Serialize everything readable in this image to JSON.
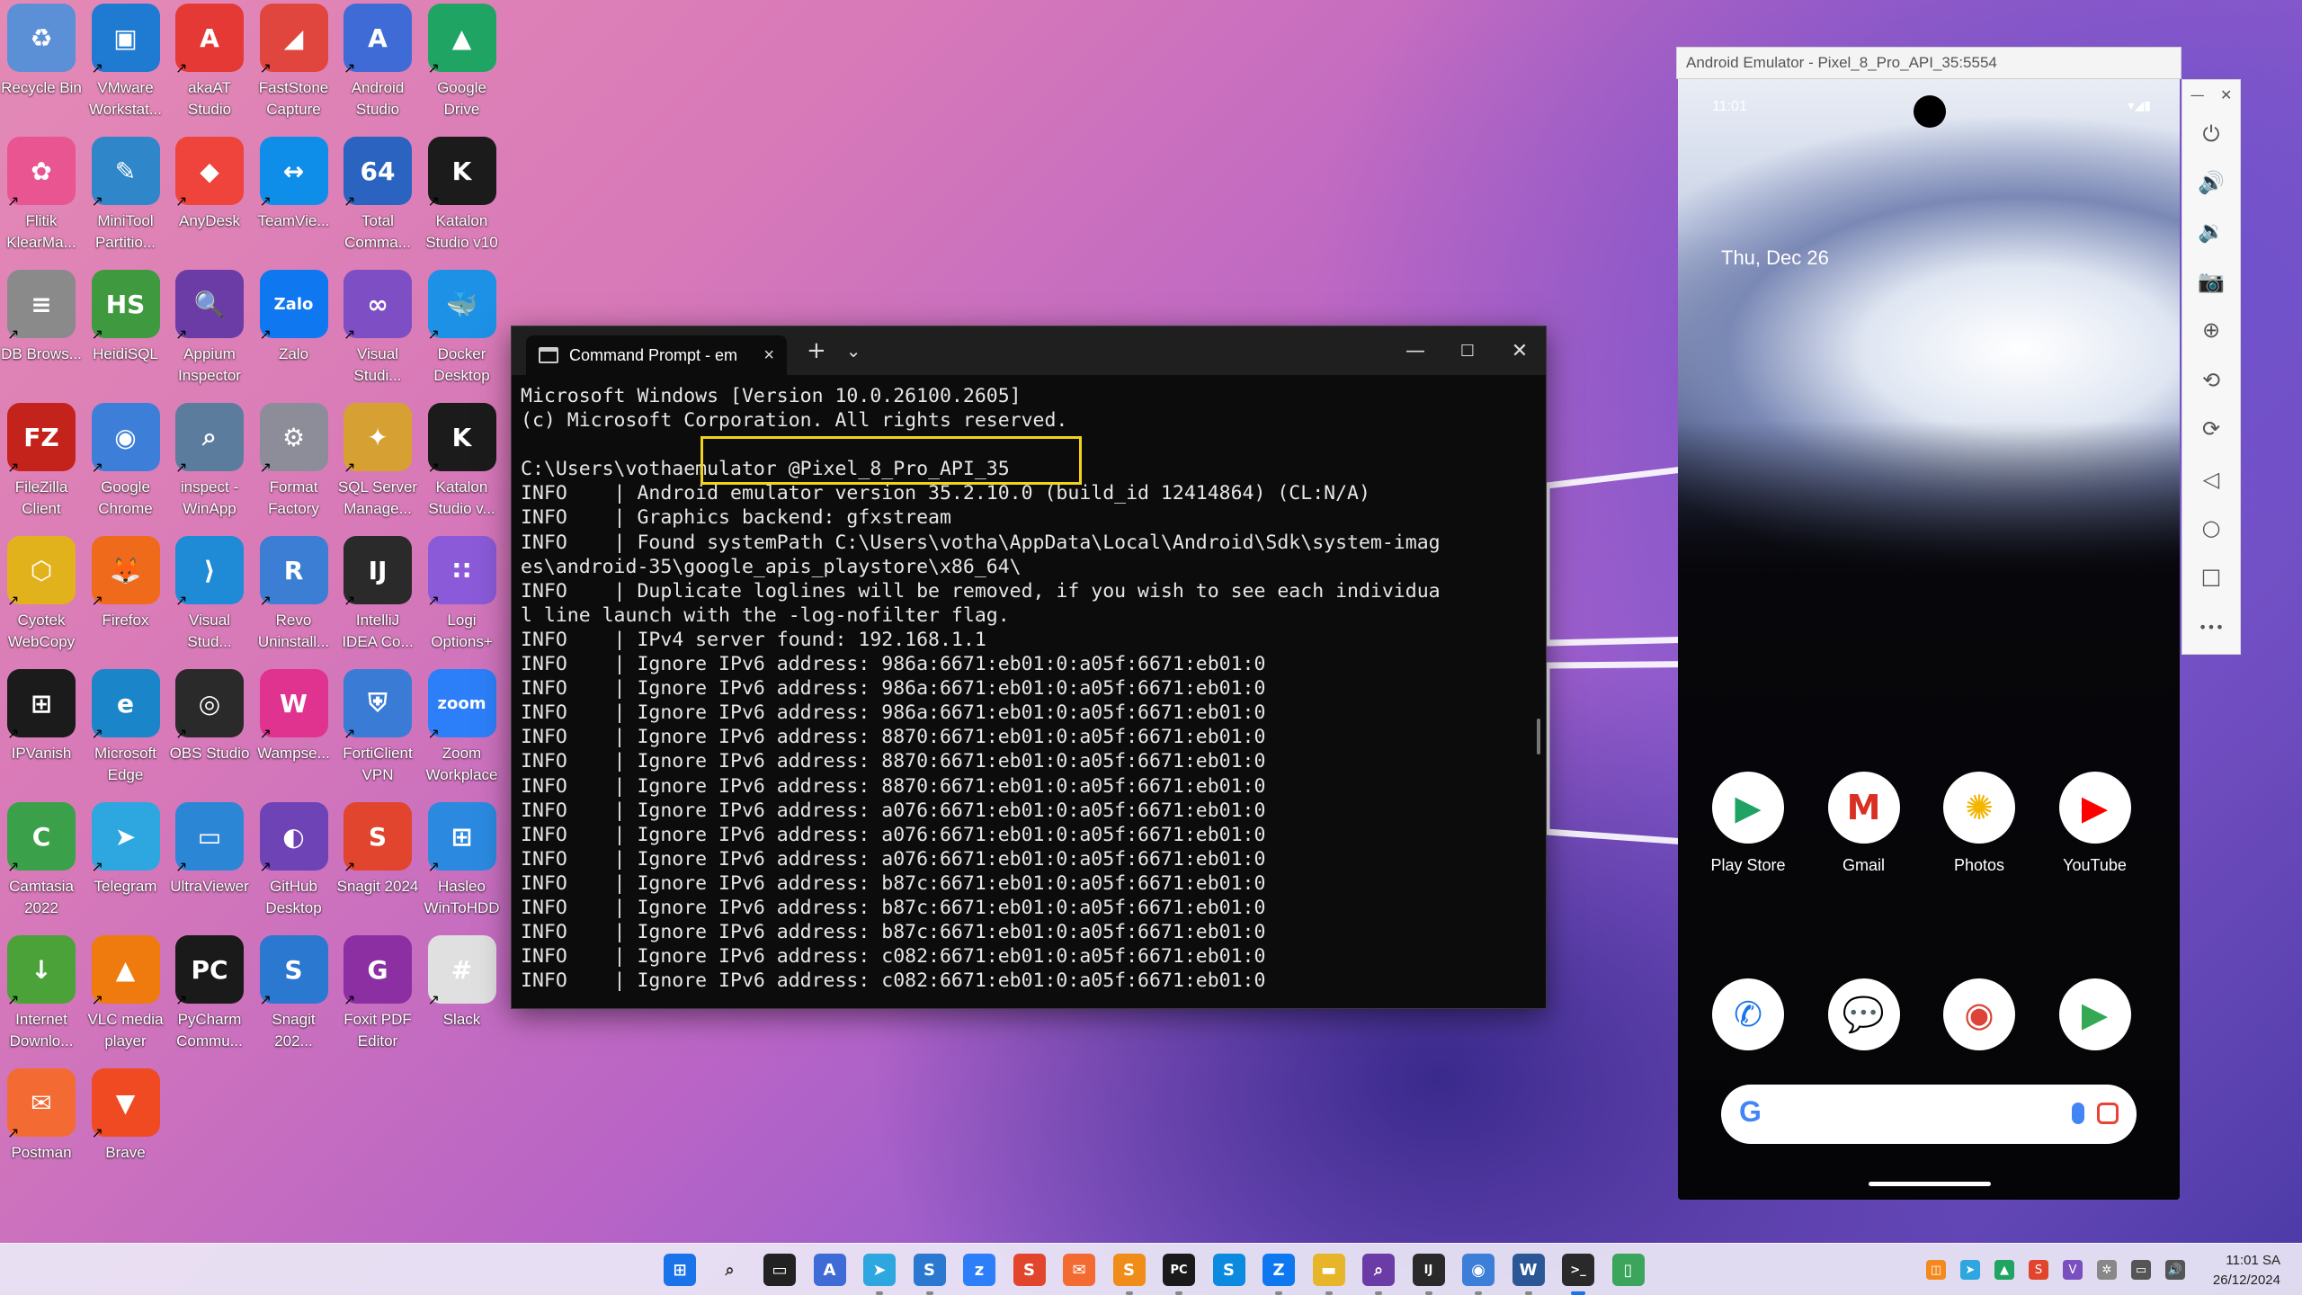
{
  "desktop": {
    "icons": [
      {
        "label": "Recycle Bin",
        "glyph": "♻",
        "color": "#5b8fd6"
      },
      {
        "label": "VMware Workstat...",
        "glyph": "▣",
        "color": "#1f7ad1"
      },
      {
        "label": "akaAT Studio",
        "glyph": "A",
        "color": "#e53935"
      },
      {
        "label": "FastStone Capture",
        "glyph": "◢",
        "color": "#e0463e"
      },
      {
        "label": "Android Studio",
        "glyph": "A",
        "color": "#3f6bd6"
      },
      {
        "label": "Google Drive",
        "glyph": "▲",
        "color": "#1fa463"
      },
      {
        "label": "Flitik KlearMa...",
        "glyph": "✿",
        "color": "#e85590"
      },
      {
        "label": "MiniTool Partitio...",
        "glyph": "✎",
        "color": "#2f86c8"
      },
      {
        "label": "AnyDesk",
        "glyph": "◆",
        "color": "#ef443b"
      },
      {
        "label": "TeamVie...",
        "glyph": "↔",
        "color": "#0e8ee9"
      },
      {
        "label": "Total Comma...",
        "glyph": "64",
        "color": "#2a64c0"
      },
      {
        "label": "Katalon Studio v10",
        "glyph": "K",
        "color": "#1b1b1b"
      },
      {
        "label": "DB Brows...",
        "glyph": "≡",
        "color": "#8a8a8a"
      },
      {
        "label": "HeidiSQL",
        "glyph": "HS",
        "color": "#3f9a3f"
      },
      {
        "label": "Appium Inspector",
        "glyph": "🔍",
        "color": "#6b3ca6"
      },
      {
        "label": "Zalo",
        "glyph": "Zalo",
        "color": "#0f78f0"
      },
      {
        "label": "Visual Studi...",
        "glyph": "∞",
        "color": "#7e4ec4"
      },
      {
        "label": "Docker Desktop",
        "glyph": "🐳",
        "color": "#1d91e6"
      },
      {
        "label": "FileZilla Client",
        "glyph": "FZ",
        "color": "#c4231c"
      },
      {
        "label": "Google Chrome",
        "glyph": "◉",
        "color": "#3d7fd8"
      },
      {
        "label": "inspect - WinApp",
        "glyph": "⌕",
        "color": "#5c7c9e"
      },
      {
        "label": "Format Factory",
        "glyph": "⚙",
        "color": "#8d8d99"
      },
      {
        "label": "SQL Server Manage...",
        "glyph": "✦",
        "color": "#d6a033"
      },
      {
        "label": "Katalon Studio v...",
        "glyph": "K",
        "color": "#1b1b1b"
      },
      {
        "label": "Cyotek WebCopy",
        "glyph": "⬡",
        "color": "#e2b21c"
      },
      {
        "label": "Firefox",
        "glyph": "🦊",
        "color": "#f06a1b"
      },
      {
        "label": "Visual Stud...",
        "glyph": "⟩",
        "color": "#1f8ad6"
      },
      {
        "label": "Revo Uninstall...",
        "glyph": "R",
        "color": "#3b7ed4"
      },
      {
        "label": "IntelliJ IDEA Co...",
        "glyph": "IJ",
        "color": "#2a2a2a"
      },
      {
        "label": "Logi Options+",
        "glyph": "∷",
        "color": "#8a5ad8"
      },
      {
        "label": "IPVanish",
        "glyph": "⊞",
        "color": "#1b1b1b"
      },
      {
        "label": "Microsoft Edge",
        "glyph": "e",
        "color": "#1a86c9"
      },
      {
        "label": "OBS Studio",
        "glyph": "◎",
        "color": "#2a2a2a"
      },
      {
        "label": "Wampse...",
        "glyph": "W",
        "color": "#e0338f"
      },
      {
        "label": "FortiClient VPN",
        "glyph": "⛨",
        "color": "#3a7bd5"
      },
      {
        "label": "Zoom Workplace",
        "glyph": "zoom",
        "color": "#2d7ff9"
      },
      {
        "label": "Camtasia 2022",
        "glyph": "C",
        "color": "#3aa04a"
      },
      {
        "label": "Telegram",
        "glyph": "➤",
        "color": "#2ea6df"
      },
      {
        "label": "UltraViewer",
        "glyph": "▭",
        "color": "#2c86d6"
      },
      {
        "label": "GitHub Desktop",
        "glyph": "◐",
        "color": "#6e43b5"
      },
      {
        "label": "Snagit 2024",
        "glyph": "S",
        "color": "#e2452d"
      },
      {
        "label": "Hasleo WinToHDD",
        "glyph": "⊞",
        "color": "#2b8ae0"
      },
      {
        "label": "Internet Downlo...",
        "glyph": "↓",
        "color": "#4aa238"
      },
      {
        "label": "VLC media player",
        "glyph": "▲",
        "color": "#ef7b0e"
      },
      {
        "label": "PyCharm Commu...",
        "glyph": "PC",
        "color": "#1a1a1a"
      },
      {
        "label": "Snagit 202...",
        "glyph": "S",
        "color": "#2a78cf"
      },
      {
        "label": "Foxit PDF Editor",
        "glyph": "G",
        "color": "#8b2fa3"
      },
      {
        "label": "Slack",
        "glyph": "#",
        "color": "#e0e0e0"
      },
      {
        "label": "Postman",
        "glyph": "✉",
        "color": "#f36b32"
      },
      {
        "label": "Brave",
        "glyph": "▼",
        "color": "#f04a22"
      }
    ]
  },
  "cmd": {
    "tab_title": "Command Prompt - em",
    "tab_close": "×",
    "new_tab": "+",
    "dropdown": "⌄",
    "minimize": "—",
    "maximize": "☐",
    "close": "✕",
    "lines": [
      "Microsoft Windows [Version 10.0.26100.2605]",
      "(c) Microsoft Corporation. All rights reserved.",
      "",
      "C:\\Users\\vothaemulator @Pixel_8_Pro_API_35",
      "INFO    | Android emulator version 35.2.10.0 (build_id 12414864) (CL:N/A)",
      "INFO    | Graphics backend: gfxstream",
      "INFO    | Found systemPath C:\\Users\\votha\\AppData\\Local\\Android\\Sdk\\system-imag",
      "es\\android-35\\google_apis_playstore\\x86_64\\",
      "INFO    | Duplicate loglines will be removed, if you wish to see each individua",
      "l line launch with the -log-nofilter flag.",
      "INFO    | IPv4 server found: 192.168.1.1",
      "INFO    | Ignore IPv6 address: 986a:6671:eb01:0:a05f:6671:eb01:0",
      "INFO    | Ignore IPv6 address: 986a:6671:eb01:0:a05f:6671:eb01:0",
      "INFO    | Ignore IPv6 address: 986a:6671:eb01:0:a05f:6671:eb01:0",
      "INFO    | Ignore IPv6 address: 8870:6671:eb01:0:a05f:6671:eb01:0",
      "INFO    | Ignore IPv6 address: 8870:6671:eb01:0:a05f:6671:eb01:0",
      "INFO    | Ignore IPv6 address: 8870:6671:eb01:0:a05f:6671:eb01:0",
      "INFO    | Ignore IPv6 address: a076:6671:eb01:0:a05f:6671:eb01:0",
      "INFO    | Ignore IPv6 address: a076:6671:eb01:0:a05f:6671:eb01:0",
      "INFO    | Ignore IPv6 address: a076:6671:eb01:0:a05f:6671:eb01:0",
      "INFO    | Ignore IPv6 address: b87c:6671:eb01:0:a05f:6671:eb01:0",
      "INFO    | Ignore IPv6 address: b87c:6671:eb01:0:a05f:6671:eb01:0",
      "INFO    | Ignore IPv6 address: b87c:6671:eb01:0:a05f:6671:eb01:0",
      "INFO    | Ignore IPv6 address: c082:6671:eb01:0:a05f:6671:eb01:0",
      "INFO    | Ignore IPv6 address: c082:6671:eb01:0:a05f:6671:eb01:0"
    ]
  },
  "emulator": {
    "window_title": "Android Emulator - Pixel_8_Pro_API_35:5554",
    "status_time": "11:01",
    "date": "Thu, Dec 26",
    "apps_row1": [
      {
        "label": "Play Store",
        "glyph": "▶",
        "color": "#1ea362"
      },
      {
        "label": "Gmail",
        "glyph": "M",
        "color": "#d93025"
      },
      {
        "label": "Photos",
        "glyph": "✺",
        "color": "#f4b400"
      },
      {
        "label": "YouTube",
        "glyph": "▶",
        "color": "#ff0000"
      }
    ],
    "apps_row2": [
      {
        "name": "phone",
        "glyph": "✆",
        "color": "#1a73e8"
      },
      {
        "name": "messages",
        "glyph": "💬",
        "color": "#1a73e8"
      },
      {
        "name": "chrome",
        "glyph": "◉",
        "color": "#db4437"
      },
      {
        "name": "play-games",
        "glyph": "▶",
        "color": "#34a853"
      }
    ],
    "search_logo": "G",
    "sidebar": {
      "minimize": "—",
      "close": "✕",
      "power": "⏻",
      "volume_up": "🔊",
      "volume_down": "🔉",
      "camera": "📷",
      "zoom": "⊕",
      "rotate_left": "⟲",
      "rotate_right": "⟳",
      "back": "◁",
      "home": "○",
      "overview": "□",
      "more": "•••"
    }
  },
  "taskbar": {
    "apps": [
      {
        "name": "start",
        "glyph": "⊞",
        "color": "#1a73e8"
      },
      {
        "name": "search",
        "glyph": "⌕",
        "color": "#333333"
      },
      {
        "name": "task-view",
        "glyph": "▭",
        "color": "#222222"
      },
      {
        "name": "android-studio",
        "glyph": "A",
        "color": "#3f6bd6"
      },
      {
        "name": "telegram",
        "glyph": "➤",
        "color": "#2ea6df"
      },
      {
        "name": "snagit",
        "glyph": "S",
        "color": "#2a78cf"
      },
      {
        "name": "zoom",
        "glyph": "z",
        "color": "#2d7ff9"
      },
      {
        "name": "snagit-editor",
        "glyph": "S",
        "color": "#e2452d"
      },
      {
        "name": "postman",
        "glyph": "✉",
        "color": "#f36b32"
      },
      {
        "name": "sublime",
        "glyph": "S",
        "color": "#ef8c1a"
      },
      {
        "name": "pycharm",
        "glyph": "PC",
        "color": "#1a1a1a"
      },
      {
        "name": "skype",
        "glyph": "S",
        "color": "#0b8ae0"
      },
      {
        "name": "zalo",
        "glyph": "Z",
        "color": "#0f78f0"
      },
      {
        "name": "file-explorer",
        "glyph": "▬",
        "color": "#e7b52a"
      },
      {
        "name": "appium",
        "glyph": "⌕",
        "color": "#6b3ca6"
      },
      {
        "name": "intellij",
        "glyph": "IJ",
        "color": "#2a2a2a"
      },
      {
        "name": "chrome",
        "glyph": "◉",
        "color": "#3d7fd8"
      },
      {
        "name": "word",
        "glyph": "W",
        "color": "#2b5797"
      },
      {
        "name": "terminal",
        "glyph": ">_",
        "color": "#2a2a2a"
      },
      {
        "name": "android-studio-2",
        "glyph": "▯",
        "color": "#3ba55c"
      }
    ],
    "tray": [
      {
        "name": "tray-app-1",
        "glyph": "◫",
        "color": "#f3891f"
      },
      {
        "name": "tray-telegram",
        "glyph": "➤",
        "color": "#2ea6df"
      },
      {
        "name": "tray-drive",
        "glyph": "▲",
        "color": "#1fa463"
      },
      {
        "name": "tray-snagit",
        "glyph": "S",
        "color": "#e2452d"
      },
      {
        "name": "tray-v",
        "glyph": "V",
        "color": "#7a4fc0"
      },
      {
        "name": "tray-bluetooth",
        "glyph": "✲",
        "color": "#888888"
      },
      {
        "name": "tray-display",
        "glyph": "▭",
        "color": "#555555"
      },
      {
        "name": "tray-volume",
        "glyph": "🔊",
        "color": "#555555"
      }
    ],
    "clock_time": "11:01 SA",
    "clock_date": "26/12/2024"
  }
}
